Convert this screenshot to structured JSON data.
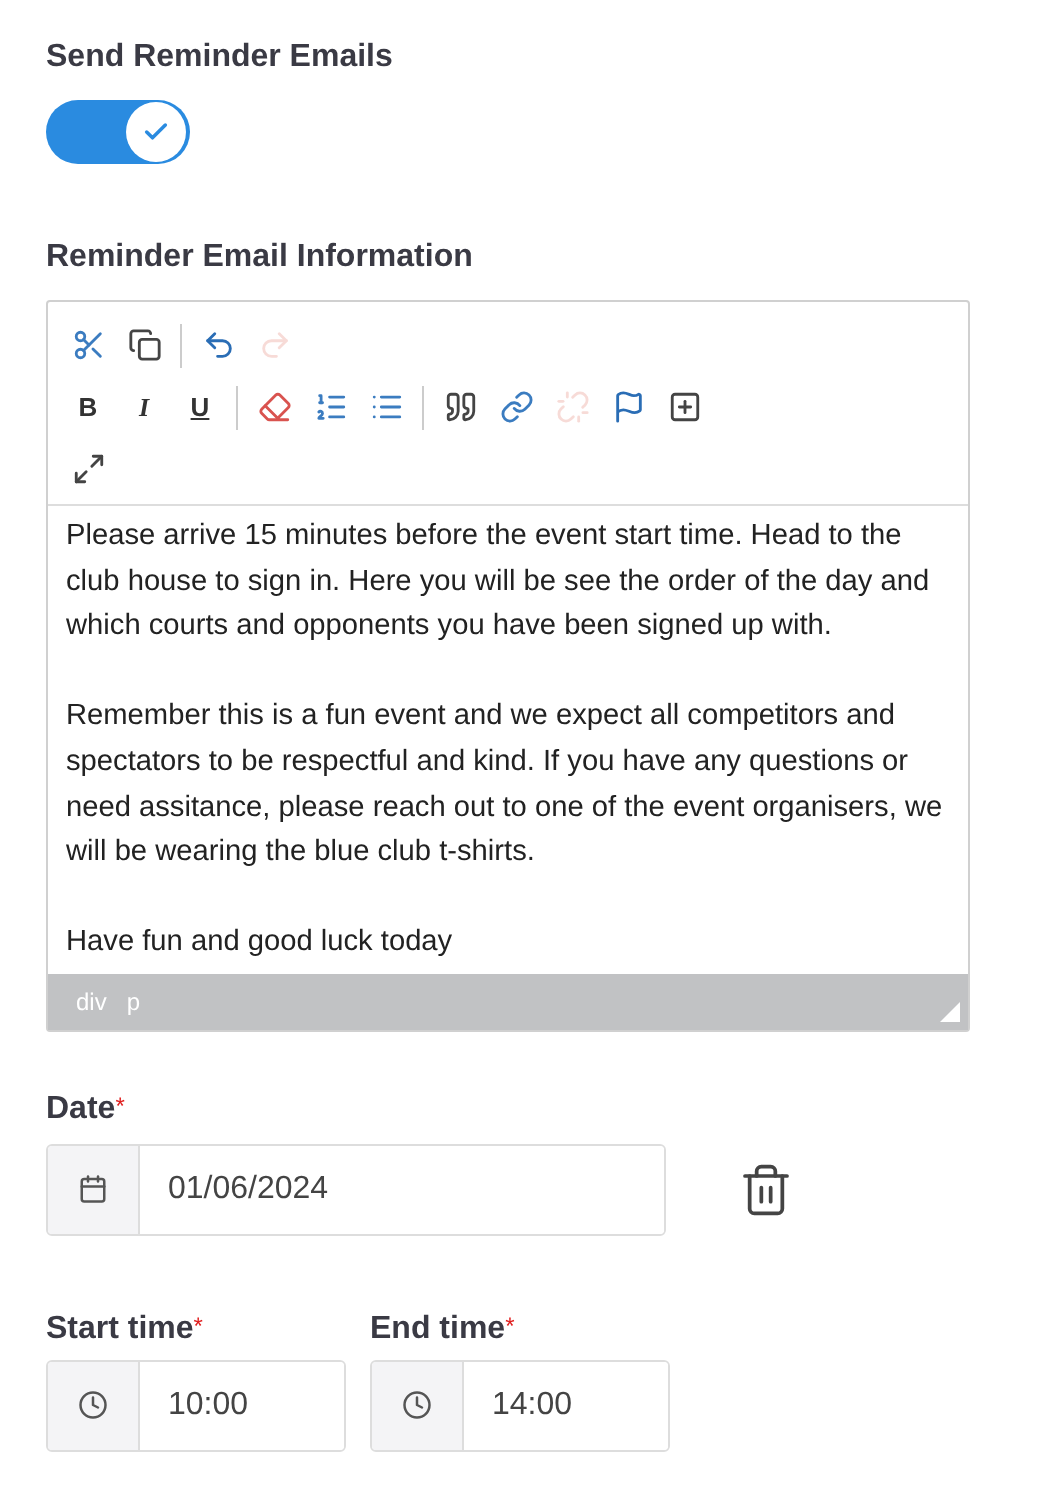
{
  "reminder_toggle": {
    "label": "Send Reminder Emails",
    "on": true
  },
  "editor": {
    "label": "Reminder Email Information",
    "toolbar_rows": [
      [
        {
          "kind": "cut",
          "disabled": false
        },
        {
          "kind": "copy",
          "disabled": false
        },
        {
          "kind": "separator"
        },
        {
          "kind": "undo",
          "disabled": false
        },
        {
          "kind": "redo",
          "disabled": true
        }
      ],
      [
        {
          "kind": "text",
          "text": "B",
          "disabled": false
        },
        {
          "kind": "text",
          "text": "I",
          "disabled": false
        },
        {
          "kind": "text",
          "text": "U",
          "disabled": false
        },
        {
          "kind": "separator"
        },
        {
          "kind": "eraser",
          "disabled": false
        },
        {
          "kind": "ordered-list",
          "disabled": false
        },
        {
          "kind": "bullet-list",
          "disabled": false
        },
        {
          "kind": "separator"
        },
        {
          "kind": "quote",
          "disabled": false
        },
        {
          "kind": "link",
          "disabled": false
        },
        {
          "kind": "unlink",
          "disabled": true
        },
        {
          "kind": "flag",
          "disabled": false
        },
        {
          "kind": "template",
          "disabled": false
        }
      ],
      [
        {
          "kind": "maximize",
          "disabled": false
        }
      ]
    ],
    "paragraphs": [
      "Please arrive 15 minutes before the event start time. Head to the club house to sign in. Here you will be see the order of the day and which courts and opponents you have been signed up with.",
      "Remember this is a fun event and we expect all competitors and spectators to be respectful and kind. If you have any questions or need assitance, please reach out to one of the event organisers, we will be wearing the blue club t-shirts.",
      "Have fun and good luck today"
    ],
    "path": [
      "div",
      "p"
    ]
  },
  "date": {
    "label": "Date",
    "required_mark": "*",
    "value": "01/06/2024"
  },
  "times": [
    {
      "label": "Start time",
      "required_mark": "*",
      "value": "10:00"
    },
    {
      "label": "End time",
      "required_mark": "*",
      "value": "14:00"
    }
  ]
}
